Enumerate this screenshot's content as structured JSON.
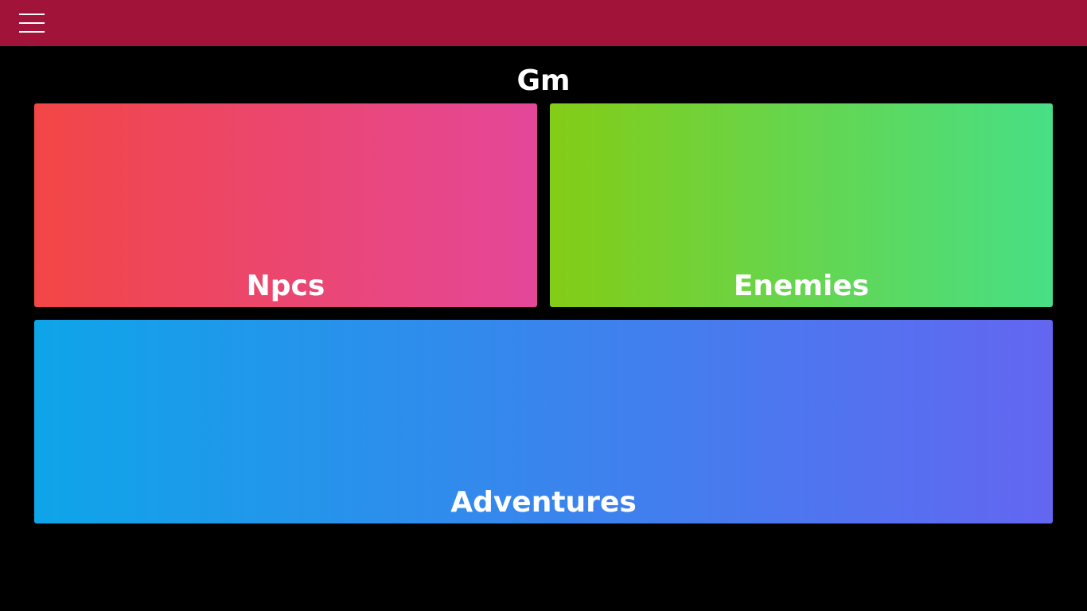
{
  "header": {
    "menu_icon": "hamburger-menu-icon",
    "background_color": "#a21339"
  },
  "page": {
    "title": "Gm"
  },
  "tiles": [
    {
      "label": "Npcs",
      "gradient": [
        "#f24646",
        "#e44799"
      ]
    },
    {
      "label": "Enemies",
      "gradient": [
        "#84cc16",
        "#47df86"
      ]
    },
    {
      "label": "Adventures",
      "gradient": [
        "#0ea5e9",
        "#6366f1"
      ]
    }
  ]
}
